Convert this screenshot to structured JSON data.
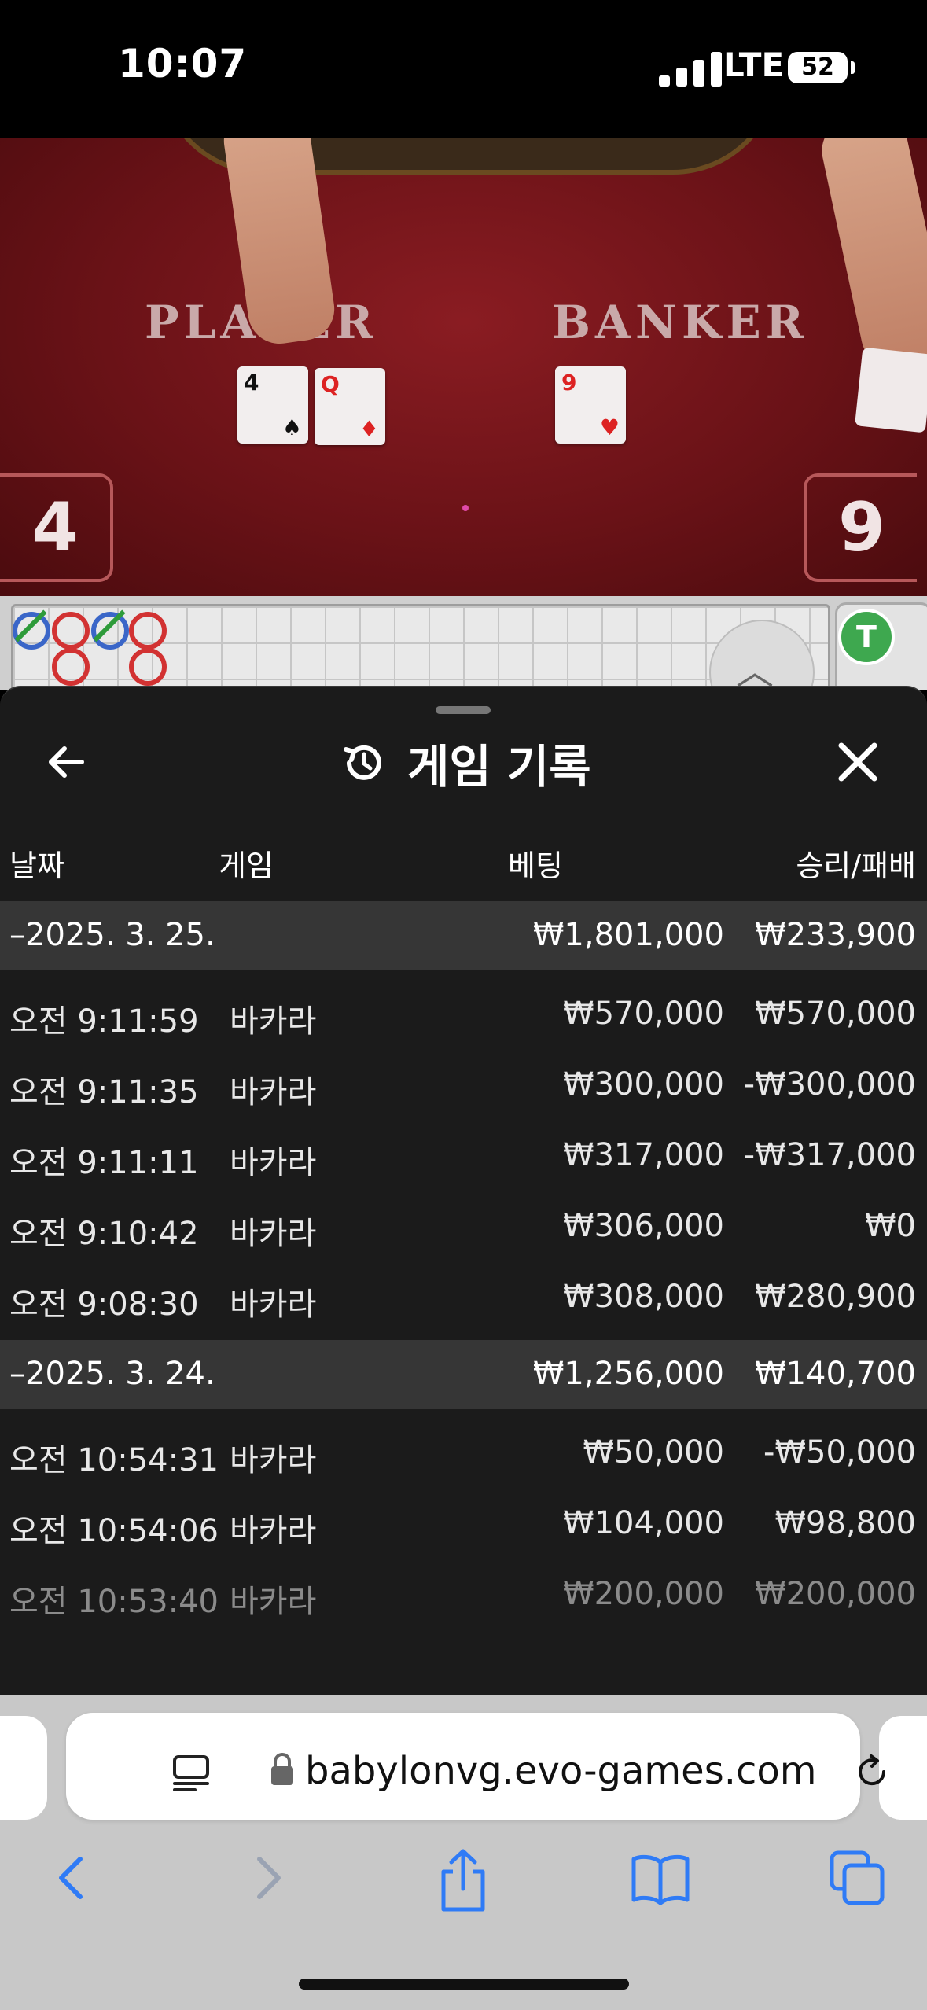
{
  "status_bar": {
    "time": "10:07",
    "network": "LTE",
    "battery": "52"
  },
  "video": {
    "player_label": "PLAYER",
    "banker_label": "BANKER",
    "player_score": "4",
    "banker_score": "9",
    "player_cards": [
      {
        "rank": "4",
        "suit": "♠"
      },
      {
        "rank": "Q",
        "suit": "♦"
      }
    ],
    "banker_cards": [
      {
        "rank": "9",
        "suit": "♥"
      }
    ]
  },
  "road": {
    "badge": "T"
  },
  "history": {
    "title": "게임 기록",
    "columns": {
      "date": "날짜",
      "game": "게임",
      "bet": "베팅",
      "win": "승리/패배"
    },
    "groups": [
      {
        "date": "–2025. 3. 25.",
        "bet_total": "₩1,801,000",
        "win_total": "₩233,900",
        "rows": [
          {
            "time": "오전 9:11:59",
            "game": "바카라",
            "bet": "₩570,000",
            "win": "₩570,000"
          },
          {
            "time": "오전 9:11:35",
            "game": "바카라",
            "bet": "₩300,000",
            "win": "-₩300,000"
          },
          {
            "time": "오전 9:11:11",
            "game": "바카라",
            "bet": "₩317,000",
            "win": "-₩317,000"
          },
          {
            "time": "오전 9:10:42",
            "game": "바카라",
            "bet": "₩306,000",
            "win": "₩0"
          },
          {
            "time": "오전 9:08:30",
            "game": "바카라",
            "bet": "₩308,000",
            "win": "₩280,900"
          }
        ]
      },
      {
        "date": "–2025. 3. 24.",
        "bet_total": "₩1,256,000",
        "win_total": "₩140,700",
        "rows": [
          {
            "time": "오전 10:54:31",
            "game": "바카라",
            "bet": "₩50,000",
            "win": "-₩50,000"
          },
          {
            "time": "오전 10:54:06",
            "game": "바카라",
            "bet": "₩104,000",
            "win": "₩98,800"
          },
          {
            "time": "오전 10:53:40",
            "game": "바카라",
            "bet": "₩200,000",
            "win": "₩200,000"
          }
        ]
      }
    ]
  },
  "browser": {
    "url": "babylonvg.evo-games.com"
  },
  "colors": {
    "sheet_bg": "#1b1b1b",
    "group_bg": "#363636",
    "felt": "#7a161c",
    "ios_blue": "#2f7bf6"
  }
}
